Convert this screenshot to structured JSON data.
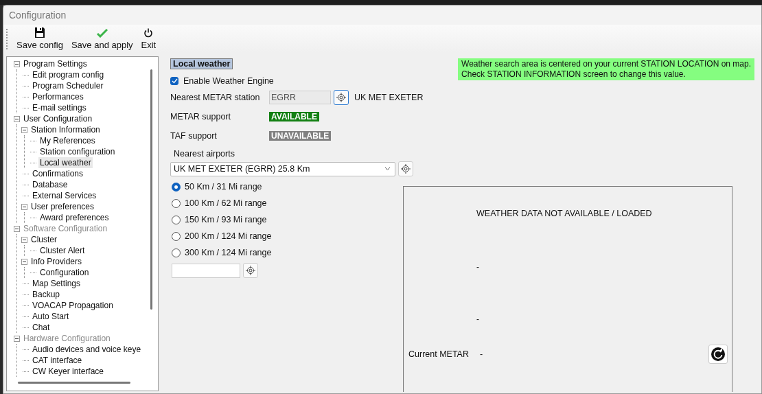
{
  "window": {
    "title": "Configuration"
  },
  "toolbar": [
    {
      "kind": "save",
      "label": "Save config"
    },
    {
      "kind": "apply",
      "label": "Save and apply"
    },
    {
      "kind": "exit",
      "label": "Exit"
    }
  ],
  "tree": [
    {
      "label": "Program Settings",
      "expanded": true,
      "selected": false,
      "disabled": false,
      "children": [
        {
          "label": "Edit program config",
          "selected": false,
          "disabled": false
        },
        {
          "label": "Program Scheduler",
          "selected": false,
          "disabled": false
        },
        {
          "label": "Performances",
          "selected": false,
          "disabled": false
        },
        {
          "label": "E-mail settings",
          "selected": false,
          "disabled": false
        }
      ]
    },
    {
      "label": "User Configuration",
      "expanded": true,
      "selected": false,
      "disabled": false,
      "children": [
        {
          "label": "Station Information",
          "expanded": true,
          "selected": false,
          "disabled": false,
          "children": [
            {
              "label": "My References",
              "selected": false,
              "disabled": false
            },
            {
              "label": "Station configuration",
              "selected": false,
              "disabled": false
            },
            {
              "label": "Local weather",
              "selected": true,
              "disabled": false
            }
          ]
        },
        {
          "label": "Confirmations",
          "selected": false,
          "disabled": false
        },
        {
          "label": "Database",
          "selected": false,
          "disabled": false
        },
        {
          "label": "External Services",
          "selected": false,
          "disabled": false
        },
        {
          "label": "User preferences",
          "expanded": true,
          "selected": false,
          "disabled": false,
          "children": [
            {
              "label": "Award preferences",
              "selected": false,
              "disabled": false
            }
          ]
        }
      ]
    },
    {
      "label": "Software Configuration",
      "expanded": true,
      "selected": false,
      "disabled": true,
      "children": [
        {
          "label": "Cluster",
          "expanded": true,
          "selected": false,
          "disabled": false,
          "children": [
            {
              "label": "Cluster Alert",
              "selected": false,
              "disabled": false
            }
          ]
        },
        {
          "label": "Info Providers",
          "expanded": true,
          "selected": false,
          "disabled": false,
          "children": [
            {
              "label": "Configuration",
              "selected": false,
              "disabled": false
            }
          ]
        },
        {
          "label": "Map Settings",
          "selected": false,
          "disabled": false
        },
        {
          "label": "Backup",
          "selected": false,
          "disabled": false
        },
        {
          "label": "VOACAP Propagation",
          "selected": false,
          "disabled": false
        },
        {
          "label": "Auto Start",
          "selected": false,
          "disabled": false
        },
        {
          "label": "Chat",
          "selected": false,
          "disabled": false
        }
      ]
    },
    {
      "label": "Hardware Configuration",
      "expanded": true,
      "selected": false,
      "disabled": true,
      "children": [
        {
          "label": "Audio devices and voice keye",
          "selected": false,
          "disabled": false
        },
        {
          "label": "CAT interface",
          "selected": false,
          "disabled": false
        },
        {
          "label": "CW Keyer interface",
          "selected": false,
          "disabled": false
        }
      ]
    }
  ],
  "section_title": "Local weather",
  "info_note": [
    "Weather search area is centered on your current STATION LOCATION on map.",
    "Check STATION INFORMATION screen to change this value."
  ],
  "enable_weather": {
    "label": "Enable Weather Engine",
    "checked": true
  },
  "metar_station": {
    "label": "Nearest METAR station",
    "value": "EGRR",
    "disabled": true,
    "station_name": "UK MET EXETER"
  },
  "support": [
    {
      "label": "METAR support",
      "status": "AVAILABLE",
      "available": true
    },
    {
      "label": "TAF support",
      "status": "UNAVAILABLE",
      "available": false
    }
  ],
  "nearest_airports": {
    "label": "Nearest airports",
    "value": "UK MET EXETER (EGRR) 25.8 Km"
  },
  "ranges": [
    {
      "label": "50 Km / 31 Mi range",
      "selected": true
    },
    {
      "label": "100 Km / 62 Mi range",
      "selected": false
    },
    {
      "label": "150 Km / 93 Mi range",
      "selected": false
    },
    {
      "label": "200 Km / 124 Mi range",
      "selected": false
    },
    {
      "label": "300 Km / 124 Mi range",
      "selected": false
    }
  ],
  "weather_panel": {
    "status": "WEATHER DATA NOT AVAILABLE / LOADED",
    "lines": [
      "-",
      "-"
    ],
    "current_metar": {
      "label": "Current METAR",
      "value": "-"
    }
  }
}
